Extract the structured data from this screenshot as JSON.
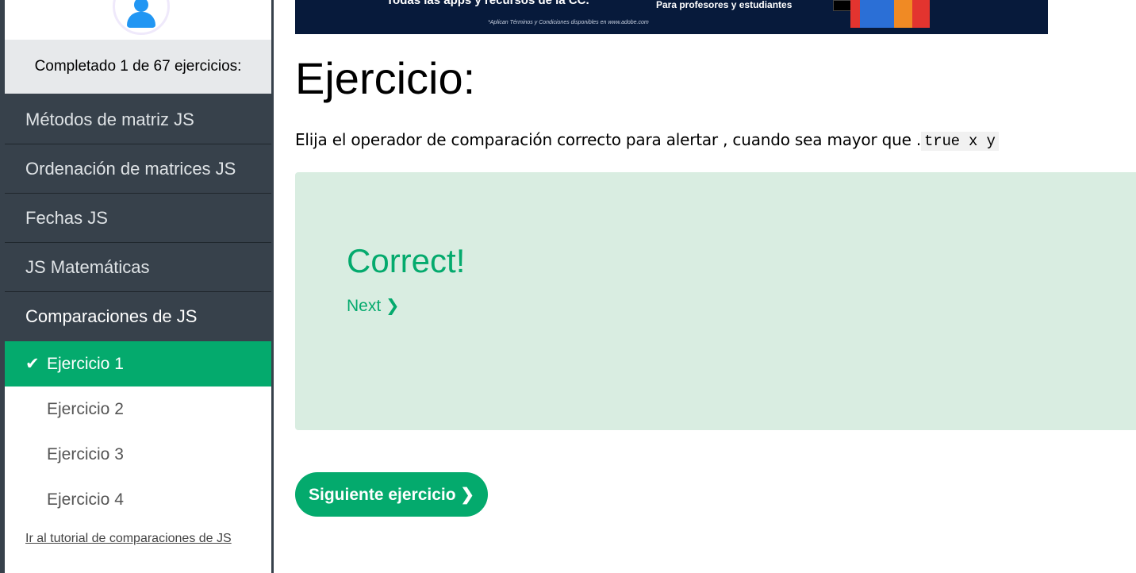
{
  "sidebar": {
    "progress_text": "Completado 1 de 67 ejercicios:",
    "menu": [
      {
        "label": "Métodos de matriz JS"
      },
      {
        "label": "Ordenación de matrices JS"
      },
      {
        "label": "Fechas JS"
      },
      {
        "label": "JS Matemáticas"
      },
      {
        "label": "Comparaciones de JS"
      }
    ],
    "exercises": [
      {
        "label": "Ejercicio 1",
        "done": true
      },
      {
        "label": "Ejercicio 2"
      },
      {
        "label": "Ejercicio 3"
      },
      {
        "label": "Ejercicio 4"
      }
    ],
    "check_glyph": "✔",
    "tutorial_link": "Ir al tutorial de comparaciones de JS"
  },
  "banner": {
    "headline": "Todas las apps y recursos de la CC.",
    "audience": "Para profesores y estudiantes",
    "note": "*Aplican Términos y Condiciones disponibles en www.adobe.com"
  },
  "main": {
    "title": "Ejercicio:",
    "prompt_before": "Elija el operador de comparación correcto para alertar , cuando sea mayor que .",
    "prompt_code": "true x y",
    "result": {
      "message": "Correct!",
      "next_label": "Next ❯"
    },
    "next_exercise_button": "Siguiente ejercicio ❯"
  },
  "colors": {
    "accent": "#04aa6d",
    "sidebar_dark": "#37414b",
    "result_bg": "#d9ede1"
  }
}
